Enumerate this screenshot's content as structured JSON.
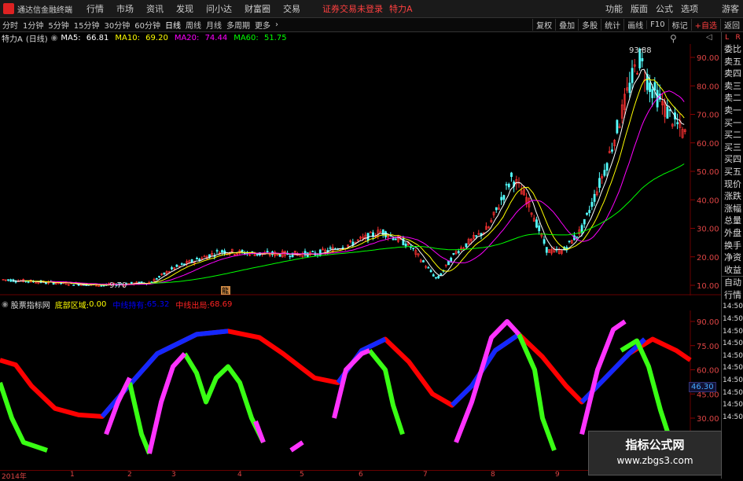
{
  "titlebar": {
    "app_title": "通达信金融终端",
    "menus": [
      "行情",
      "市场",
      "资讯",
      "发现",
      "问小达",
      "财富圈",
      "交易"
    ],
    "alert": "证券交易未登录",
    "stock_name": "特力A",
    "right_menus": [
      "功能",
      "版面",
      "公式",
      "选项"
    ],
    "guest": "游客"
  },
  "periodbar": {
    "periods": [
      "分时",
      "1分钟",
      "5分钟",
      "15分钟",
      "30分钟",
      "60分钟",
      "日线",
      "周线",
      "月线",
      "多周期",
      "更多"
    ],
    "active_period": "日线",
    "tools": [
      "复权",
      "叠加",
      "多股",
      "统计",
      "画线",
      "F10",
      "标记",
      "+自选",
      "返回"
    ]
  },
  "main_legend": {
    "stock": "特力A",
    "period": "(日线)",
    "ma5_label": "MA5:",
    "ma5_value": "66.81",
    "ma10_label": "MA10:",
    "ma10_value": "69.20",
    "ma20_label": "MA20:",
    "ma20_value": "74.44",
    "ma60_label": "MA60:",
    "ma60_value": "51.75"
  },
  "main_chart": {
    "y_ticks": [
      "90.00",
      "80.00",
      "70.00",
      "60.00",
      "50.00",
      "40.00",
      "30.00",
      "20.00",
      "10.00"
    ],
    "y_values": [
      90,
      80,
      70,
      60,
      50,
      40,
      30,
      20,
      10
    ],
    "high_label": "93.88",
    "low_label": "9.70",
    "flag_label": "龍"
  },
  "indicator_legend": {
    "name": "股票指标网",
    "bottom_label": "底部区域:",
    "bottom_value": "0.00",
    "mid_label": "中线持有:",
    "mid_value": "65.32",
    "exit_label": "中线出局:",
    "exit_value": "68.69"
  },
  "indicator_chart": {
    "y_ticks": [
      "90.00",
      "75.00",
      "60.00",
      "45.00",
      "30.00"
    ],
    "y_values": [
      90,
      75,
      60,
      45,
      30
    ],
    "value_tag": "46.30"
  },
  "xaxis": {
    "labels": [
      "2014年",
      "1",
      "2",
      "3",
      "4",
      "5",
      "6",
      "7",
      "8",
      "9"
    ]
  },
  "rightcol": {
    "top_labels": [
      "L",
      "R"
    ],
    "items": [
      "委比",
      "卖五",
      "卖四",
      "卖三",
      "卖二",
      "卖一",
      "买一",
      "买二",
      "买三",
      "买四",
      "买五",
      "现价",
      "涨跌",
      "涨幅",
      "总量",
      "外盘",
      "换手",
      "净资",
      "收益"
    ],
    "items2": [
      "自动",
      "行情",
      "14:50",
      "14:50",
      "14:50",
      "14:50",
      "14:50",
      "14:50",
      "14:50",
      "14:50",
      "14:50",
      "14:50"
    ]
  },
  "watermark": {
    "line1": "指标公式网",
    "line2": "www.zbgs3.com"
  },
  "colors": {
    "ma5": "#ffffff",
    "ma10": "#ffff00",
    "ma20": "#ff00ff",
    "ma60": "#00ff00",
    "up": "#ff3232",
    "down": "#54ffff",
    "bottom": "#ffff00",
    "mid": "#0000ff",
    "exit": "#ff0000"
  }
}
